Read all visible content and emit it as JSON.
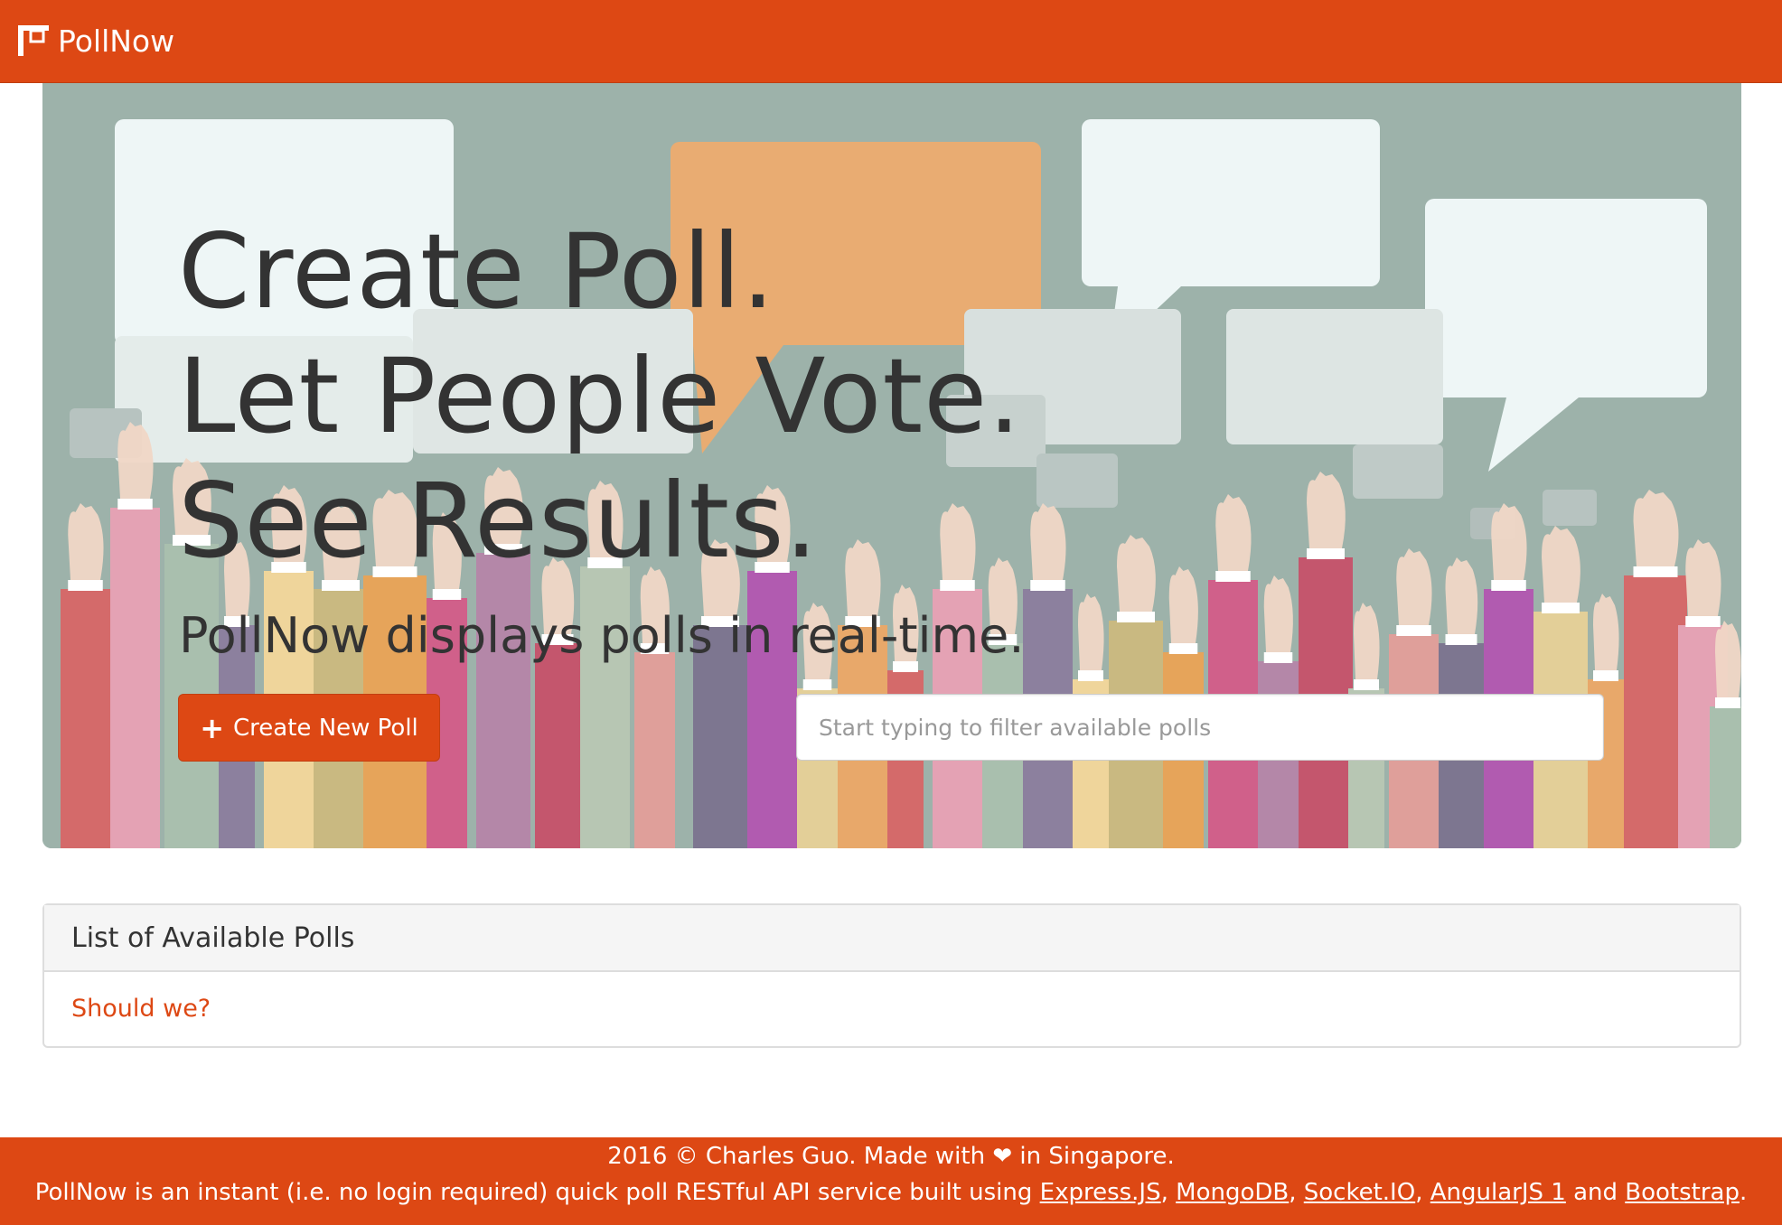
{
  "navbar": {
    "brand": "PollNow",
    "logo_icon": "pollnow-logo-icon"
  },
  "hero": {
    "headline_line1": "Create Poll.",
    "headline_line2": "Let People Vote.",
    "headline_line3": "See Results.",
    "lead": "PollNow displays polls in real-time.",
    "create_button_label": "Create New Poll",
    "create_button_icon": "plus-icon",
    "filter_placeholder": "Start typing to filter available polls",
    "filter_value": ""
  },
  "polls_panel": {
    "title": "List of Available Polls",
    "items": [
      {
        "label": "Should we?"
      }
    ]
  },
  "footer": {
    "line1_prefix": "2016 © Charles Guo. Made with",
    "heart_icon": "heart-icon",
    "heart_glyph": "❤",
    "line1_suffix": "in Singapore.",
    "line2_prefix": "PollNow is an instant (i.e. no login required) quick poll RESTful API service built using",
    "links": [
      "Express.JS",
      "MongoDB",
      "Socket.IO",
      "AngularJS 1",
      "Bootstrap"
    ],
    "sep_comma": ",",
    "and_word": "and",
    "period": "."
  },
  "colors": {
    "brand": "#dd4814",
    "hero_bg": "#9db2aa",
    "text": "#333333",
    "panel_heading_bg": "#f5f5f5"
  }
}
